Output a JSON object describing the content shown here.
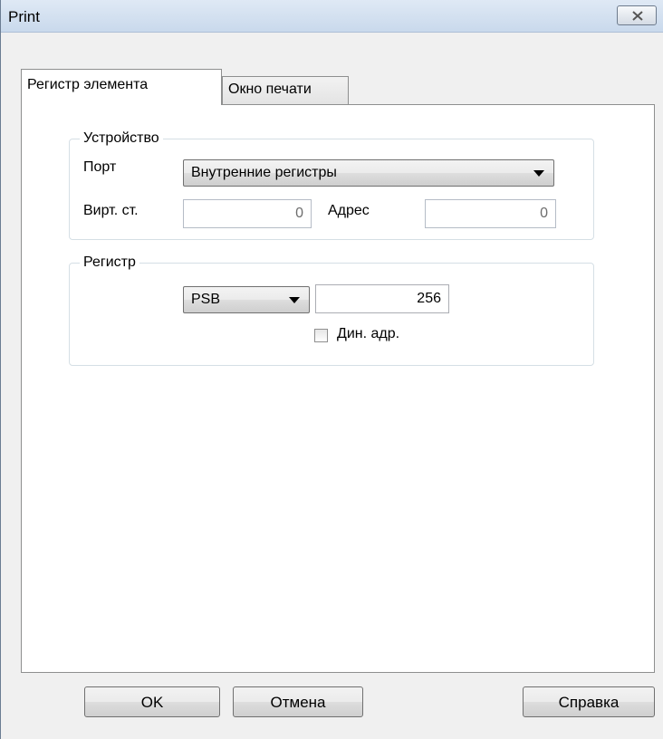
{
  "window": {
    "title": "Print"
  },
  "tabs": [
    {
      "label": "Регистр элемента",
      "active": true
    },
    {
      "label": "Окно печати",
      "active": false
    }
  ],
  "device_group": {
    "legend": "Устройство",
    "port_label": "Порт",
    "port_value": "Внутренние регистры",
    "virt_label": "Вирт. ст.",
    "virt_value": "0",
    "address_label": "Адрес",
    "address_value": "0"
  },
  "register_group": {
    "legend": "Регистр",
    "type_value": "PSB",
    "number_value": "256",
    "dyn_addr_label": "Дин. адр.",
    "dyn_addr_checked": false
  },
  "buttons": {
    "ok": "OK",
    "cancel": "Отмена",
    "help": "Справка"
  }
}
